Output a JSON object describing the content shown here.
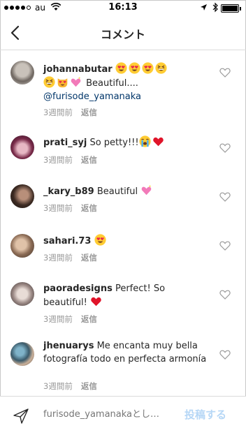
{
  "status_bar": {
    "carrier": "au",
    "time": "16:13",
    "battery_level": 1.0
  },
  "nav": {
    "title": "コメント"
  },
  "comments": [
    {
      "username": "johannabutar",
      "text": "Beautiful....",
      "mention": "@furisode_yamanaka",
      "emoji_before": [
        "heart-eyes-emoji",
        "heart-eyes-emoji",
        "heart-eyes-emoji",
        "grinning-squint-emoji",
        "grinning-squint-emoji",
        "heart-eyes-cat-emoji",
        "sparkling-heart-emoji"
      ],
      "time": "3週間前",
      "reply": "返信"
    },
    {
      "username": "prati_syj",
      "text": "So petty!!!",
      "emoji_after": [
        "crying-emoji",
        "red-heart-emoji"
      ],
      "time": "3週間前",
      "reply": "返信"
    },
    {
      "username": "_kary_b89",
      "text": "Beautiful",
      "emoji_after": [
        "sparkling-heart-emoji"
      ],
      "time": "3週間前",
      "reply": "返信"
    },
    {
      "username": "sahari.73",
      "text": "",
      "emoji_after": [
        "heart-eyes-emoji"
      ],
      "time": "3週間前",
      "reply": "返信"
    },
    {
      "username": "paoradesigns",
      "text": "Perfect! So beautiful!",
      "emoji_after": [
        "red-heart-emoji"
      ],
      "time": "3週間前",
      "reply": "返信"
    },
    {
      "username": "jhenuarys",
      "text": "Me encanta muy bella fotografía todo en perfecta armonía",
      "time": "3週間前",
      "reply": "返信"
    }
  ],
  "input": {
    "placeholder": "furisode_yamanakaとし…",
    "post_label": "投稿する"
  },
  "colors": {
    "link": "#003569",
    "meta": "#999999",
    "post_disabled": "#b6d7f6",
    "divider": "#dbdbdb"
  }
}
